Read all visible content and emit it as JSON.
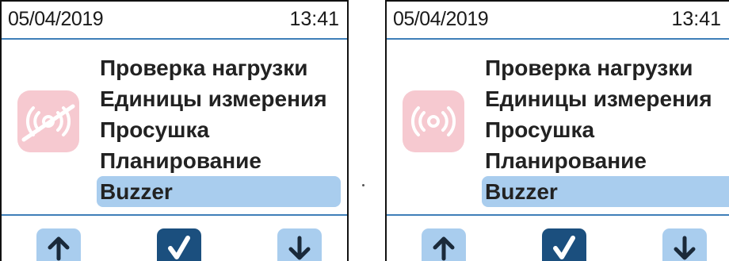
{
  "screens": [
    {
      "date": "05/04/2019",
      "time": "13:41",
      "feature_icon": "buzzer-off-icon",
      "menu": [
        {
          "label": "Проверка нагрузки"
        },
        {
          "label": "Единицы измерения"
        },
        {
          "label": "Просушка"
        },
        {
          "label": "Планирование"
        },
        {
          "label": "Buzzer",
          "selected": true
        }
      ],
      "buttons": [
        "arrow-up-icon",
        "checkmark-icon",
        "arrow-down-icon"
      ]
    },
    {
      "date": "05/04/2019",
      "time": "13:41",
      "feature_icon": "buzzer-on-icon",
      "menu": [
        {
          "label": "Проверка нагрузки"
        },
        {
          "label": "Единицы измерения"
        },
        {
          "label": "Просушка"
        },
        {
          "label": "Планирование"
        },
        {
          "label": "Buzzer",
          "selected": true
        }
      ],
      "buttons": [
        "arrow-up-icon",
        "checkmark-icon",
        "arrow-down-icon"
      ]
    }
  ],
  "colors": {
    "accent_line": "#3f7fb8",
    "selection": "#a9cdee",
    "confirm_button": "#1b4f7e",
    "buzzer_tile": "#f6c9d0"
  }
}
